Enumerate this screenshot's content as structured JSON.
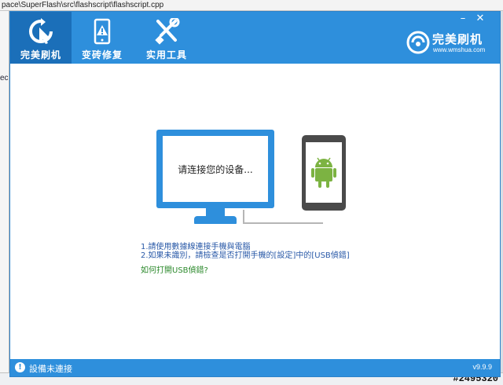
{
  "background": {
    "title_path": "pace\\SuperFlash\\src\\flashscript\\flashscript.cpp",
    "left_fragment": "ec",
    "watermark": "#2495320"
  },
  "app": {
    "nav": [
      {
        "label": "完美刷机",
        "icon": "refresh-cursor-icon",
        "active": true
      },
      {
        "label": "变砖修复",
        "icon": "tablet-warning-icon",
        "active": false
      },
      {
        "label": "实用工具",
        "icon": "wrench-screwdriver-icon",
        "active": false
      }
    ],
    "window_controls": {
      "minimize": "–",
      "close": "✕"
    },
    "brand": {
      "name": "完美刷机",
      "url": "www.wmshua.com"
    },
    "illustration": {
      "monitor_text": "请连接您的设备..."
    },
    "instructions": {
      "line1": "1.請使用數據線連接手機與電腦",
      "line2": "2.如果未識別，請檢查是否打開手機的[設定]中的[USB偵錯]",
      "link": "如何打開USB偵錯?"
    },
    "status": {
      "text": "設備未連接",
      "version": "v9.9.9"
    },
    "colors": {
      "primary": "#2e8fdc",
      "active_tab": "#1b6fb9",
      "instruction_text": "#2a5aa8",
      "link_text": "#2d8a2d"
    }
  }
}
